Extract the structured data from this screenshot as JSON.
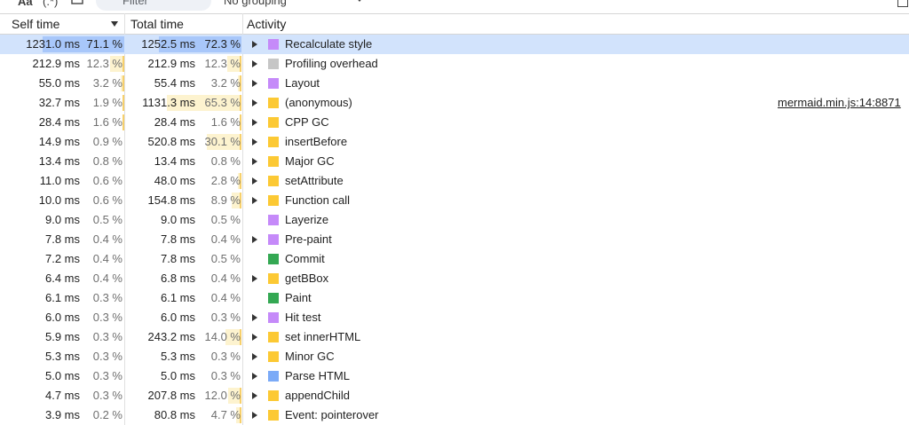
{
  "toolbar": {
    "match_case": "Aa",
    "regex": "(.*)",
    "filter_placeholder": "Filter",
    "grouping": "No grouping"
  },
  "columns": {
    "self_time": "Self time",
    "total_time": "Total time",
    "activity": "Activity"
  },
  "colors": {
    "rendering": "#c58af9",
    "system": "#c6c6c6",
    "scripting": "#fcc934",
    "painting": "#34a853",
    "loading": "#7baaf7"
  },
  "rows": [
    {
      "self_ms": "1231.0 ms",
      "self_pct": "71.1 %",
      "self_frac": 0.711,
      "total_ms": "1252.5 ms",
      "total_pct": "72.3 %",
      "total_frac": 0.723,
      "name": "Recalculate style",
      "category": "rendering",
      "expandable": true,
      "source": "",
      "selected": true
    },
    {
      "self_ms": "212.9 ms",
      "self_pct": "12.3 %",
      "self_frac": 0.123,
      "total_ms": "212.9 ms",
      "total_pct": "12.3 %",
      "total_frac": 0.123,
      "name": "Profiling overhead",
      "category": "system",
      "expandable": true,
      "source": ""
    },
    {
      "self_ms": "55.0 ms",
      "self_pct": "3.2 %",
      "self_frac": 0.032,
      "total_ms": "55.4 ms",
      "total_pct": "3.2 %",
      "total_frac": 0.032,
      "name": "Layout",
      "category": "rendering",
      "expandable": true,
      "source": ""
    },
    {
      "self_ms": "32.7 ms",
      "self_pct": "1.9 %",
      "self_frac": 0.019,
      "total_ms": "1131.3 ms",
      "total_pct": "65.3 %",
      "total_frac": 0.653,
      "name": "(anonymous)",
      "category": "scripting",
      "expandable": true,
      "source": "mermaid.min.js:14:8871"
    },
    {
      "self_ms": "28.4 ms",
      "self_pct": "1.6 %",
      "self_frac": 0.016,
      "total_ms": "28.4 ms",
      "total_pct": "1.6 %",
      "total_frac": 0.016,
      "name": "CPP GC",
      "category": "scripting",
      "expandable": true,
      "source": ""
    },
    {
      "self_ms": "14.9 ms",
      "self_pct": "0.9 %",
      "self_frac": 0.009,
      "total_ms": "520.8 ms",
      "total_pct": "30.1 %",
      "total_frac": 0.301,
      "name": "insertBefore",
      "category": "scripting",
      "expandable": true,
      "source": ""
    },
    {
      "self_ms": "13.4 ms",
      "self_pct": "0.8 %",
      "self_frac": 0.008,
      "total_ms": "13.4 ms",
      "total_pct": "0.8 %",
      "total_frac": 0.008,
      "name": "Major GC",
      "category": "scripting",
      "expandable": true,
      "source": ""
    },
    {
      "self_ms": "11.0 ms",
      "self_pct": "0.6 %",
      "self_frac": 0.006,
      "total_ms": "48.0 ms",
      "total_pct": "2.8 %",
      "total_frac": 0.028,
      "name": "setAttribute",
      "category": "scripting",
      "expandable": true,
      "source": ""
    },
    {
      "self_ms": "10.0 ms",
      "self_pct": "0.6 %",
      "self_frac": 0.006,
      "total_ms": "154.8 ms",
      "total_pct": "8.9 %",
      "total_frac": 0.089,
      "name": "Function call",
      "category": "scripting",
      "expandable": true,
      "source": ""
    },
    {
      "self_ms": "9.0 ms",
      "self_pct": "0.5 %",
      "self_frac": 0.005,
      "total_ms": "9.0 ms",
      "total_pct": "0.5 %",
      "total_frac": 0.005,
      "name": "Layerize",
      "category": "rendering",
      "expandable": false,
      "source": ""
    },
    {
      "self_ms": "7.8 ms",
      "self_pct": "0.4 %",
      "self_frac": 0.004,
      "total_ms": "7.8 ms",
      "total_pct": "0.4 %",
      "total_frac": 0.004,
      "name": "Pre-paint",
      "category": "rendering",
      "expandable": true,
      "source": ""
    },
    {
      "self_ms": "7.2 ms",
      "self_pct": "0.4 %",
      "self_frac": 0.004,
      "total_ms": "7.8 ms",
      "total_pct": "0.5 %",
      "total_frac": 0.005,
      "name": "Commit",
      "category": "painting",
      "expandable": false,
      "source": ""
    },
    {
      "self_ms": "6.4 ms",
      "self_pct": "0.4 %",
      "self_frac": 0.004,
      "total_ms": "6.8 ms",
      "total_pct": "0.4 %",
      "total_frac": 0.004,
      "name": "getBBox",
      "category": "scripting",
      "expandable": true,
      "source": ""
    },
    {
      "self_ms": "6.1 ms",
      "self_pct": "0.3 %",
      "self_frac": 0.003,
      "total_ms": "6.1 ms",
      "total_pct": "0.4 %",
      "total_frac": 0.004,
      "name": "Paint",
      "category": "painting",
      "expandable": false,
      "source": ""
    },
    {
      "self_ms": "6.0 ms",
      "self_pct": "0.3 %",
      "self_frac": 0.003,
      "total_ms": "6.0 ms",
      "total_pct": "0.3 %",
      "total_frac": 0.003,
      "name": "Hit test",
      "category": "rendering",
      "expandable": true,
      "source": ""
    },
    {
      "self_ms": "5.9 ms",
      "self_pct": "0.3 %",
      "self_frac": 0.003,
      "total_ms": "243.2 ms",
      "total_pct": "14.0 %",
      "total_frac": 0.14,
      "name": "set innerHTML",
      "category": "scripting",
      "expandable": true,
      "source": ""
    },
    {
      "self_ms": "5.3 ms",
      "self_pct": "0.3 %",
      "self_frac": 0.003,
      "total_ms": "5.3 ms",
      "total_pct": "0.3 %",
      "total_frac": 0.003,
      "name": "Minor GC",
      "category": "scripting",
      "expandable": true,
      "source": ""
    },
    {
      "self_ms": "5.0 ms",
      "self_pct": "0.3 %",
      "self_frac": 0.003,
      "total_ms": "5.0 ms",
      "total_pct": "0.3 %",
      "total_frac": 0.003,
      "name": "Parse HTML",
      "category": "loading",
      "expandable": true,
      "source": ""
    },
    {
      "self_ms": "4.7 ms",
      "self_pct": "0.3 %",
      "self_frac": 0.003,
      "total_ms": "207.8 ms",
      "total_pct": "12.0 %",
      "total_frac": 0.12,
      "name": "appendChild",
      "category": "scripting",
      "expandable": true,
      "source": ""
    },
    {
      "self_ms": "3.9 ms",
      "self_pct": "0.2 %",
      "self_frac": 0.002,
      "total_ms": "80.8 ms",
      "total_pct": "4.7 %",
      "total_frac": 0.047,
      "name": "Event: pointerover",
      "category": "scripting",
      "expandable": true,
      "source": ""
    }
  ]
}
